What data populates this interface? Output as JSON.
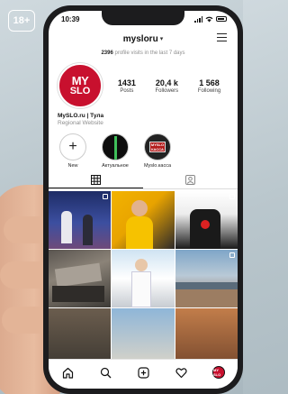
{
  "age_rating": "18+",
  "status_bar": {
    "time": "10:39"
  },
  "header": {
    "username": "mysloru"
  },
  "insights": {
    "visits_count": "2396",
    "visits_text": "profile visits in the last 7 days"
  },
  "profile": {
    "avatar_text_line1": "MY",
    "avatar_text_line2": "SLO",
    "stats": [
      {
        "value": "1431",
        "label": "Posts"
      },
      {
        "value": "20,4 k",
        "label": "Followers"
      },
      {
        "value": "1 568",
        "label": "Following"
      }
    ],
    "name": "MySLO.ru | Тула",
    "category": "Regional Website"
  },
  "highlights": [
    {
      "label": "New",
      "icon": "plus-icon"
    },
    {
      "label": "Актуальное",
      "icon": "highlight-cover"
    },
    {
      "label": "Myslo.касса",
      "icon": "highlight-cover",
      "cover_text": "MYSLO КАССА"
    }
  ],
  "tabs": [
    {
      "name": "grid",
      "icon": "grid-icon",
      "active": true
    },
    {
      "name": "tagged",
      "icon": "tagged-icon",
      "active": false
    }
  ],
  "bottom_nav": [
    {
      "icon": "home-icon"
    },
    {
      "icon": "search-icon"
    },
    {
      "icon": "add-post-icon"
    },
    {
      "icon": "heart-icon"
    },
    {
      "icon": "profile-avatar-icon",
      "text": "MY SLO"
    }
  ],
  "colors": {
    "brand_red": "#c8102e",
    "accent_yellow": "#f2b300",
    "muted_text": "#8e8e8e"
  }
}
